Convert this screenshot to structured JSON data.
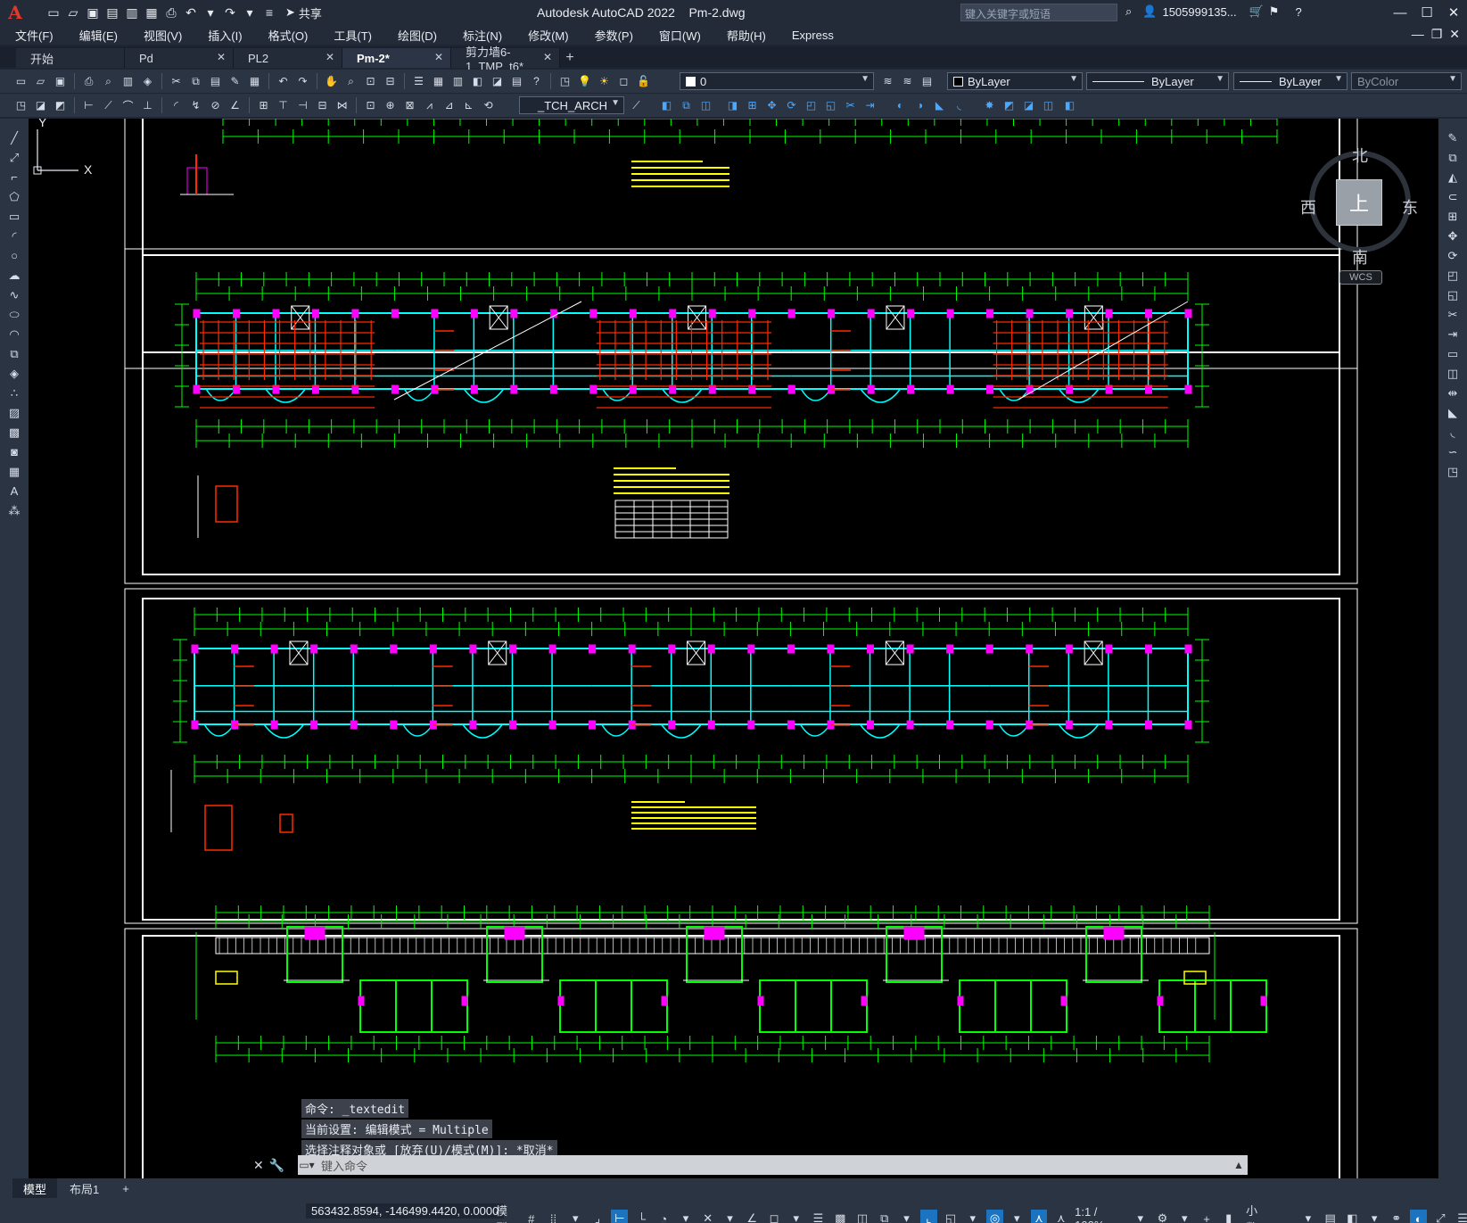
{
  "title_bar": {
    "app_name": "Autodesk AutoCAD 2022",
    "file_name": "Pm-2.dwg",
    "share_label": "共享",
    "search_placeholder": "键入关键字或短语",
    "user_name": "1505999135..."
  },
  "menu": {
    "items": [
      "文件(F)",
      "编辑(E)",
      "视图(V)",
      "插入(I)",
      "格式(O)",
      "工具(T)",
      "绘图(D)",
      "标注(N)",
      "修改(M)",
      "参数(P)",
      "窗口(W)",
      "帮助(H)",
      "Express"
    ]
  },
  "tabs": [
    {
      "label": "开始",
      "closable": false,
      "active": false
    },
    {
      "label": "Pd",
      "closable": true,
      "active": false
    },
    {
      "label": "PL2",
      "closable": true,
      "active": false
    },
    {
      "label": "Pm-2*",
      "closable": true,
      "active": true
    },
    {
      "label": "剪力墙6-1_TMP_t6*",
      "closable": true,
      "active": false
    }
  ],
  "properties": {
    "layer": "0",
    "color": "ByLayer",
    "linetype": "ByLayer",
    "lineweight": "ByLayer",
    "plotstyle": "ByColor",
    "text_style": "_TCH_ARCH"
  },
  "viewcube": {
    "north": "北",
    "south": "南",
    "east": "东",
    "west": "西",
    "face": "上",
    "wcs_label": "WCS"
  },
  "ucs": {
    "x_label": "X",
    "y_label": "Y"
  },
  "command": {
    "history": [
      "命令: _textedit",
      "当前设置: 编辑模式 = Multiple",
      "选择注释对象或 [放弃(U)/模式(M)]: *取消*"
    ],
    "input_placeholder": "键入命令"
  },
  "layout_tabs": {
    "model": "模型",
    "layout1": "布局1"
  },
  "status": {
    "coordinates": "563432.8594, -146499.4420, 0.0000",
    "model_label": "模型",
    "scale": "1:1 / 100%",
    "units": "小数"
  },
  "colors": {
    "accent": "#1c74c0",
    "drawing_green": "#00ff00",
    "drawing_cyan": "#00ffff",
    "drawing_red": "#ff2a00",
    "drawing_magenta": "#ff00ff",
    "drawing_yellow": "#ffff00"
  }
}
